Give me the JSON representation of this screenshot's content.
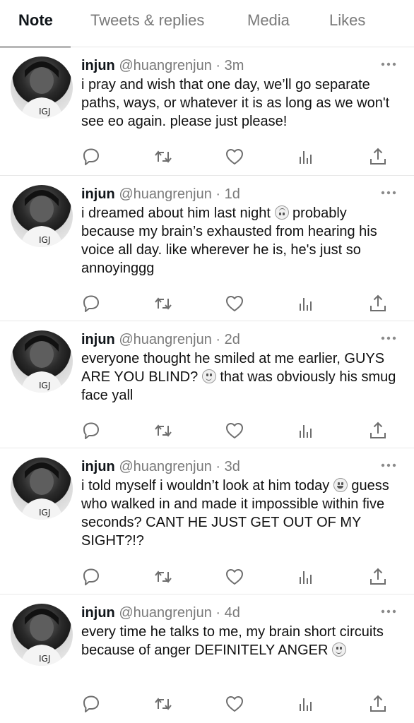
{
  "tabs": [
    {
      "label": "Note",
      "active": true
    },
    {
      "label": "Tweets & replies",
      "active": false
    },
    {
      "label": "Media",
      "active": false
    },
    {
      "label": "Likes",
      "active": false
    }
  ],
  "tweets": [
    {
      "name": "injun",
      "handle": "@huangrenjun",
      "separator": "·",
      "time": "3m",
      "text_parts": [
        "i pray and wish that one day, we’ll go separate paths, ways, or whatever it is as long as we won't see eo again. please just please!"
      ]
    },
    {
      "name": "injun",
      "handle": "@huangrenjun",
      "separator": "·",
      "time": "1d",
      "text_parts": [
        "i dreamed about him last night ",
        " probably because my brain’s exhausted from hearing his voice all day. like wherever he is, he's just so annoyinggg"
      ],
      "emoji": "upside-down-face"
    },
    {
      "name": "injun",
      "handle": "@huangrenjun",
      "separator": "·",
      "time": "2d",
      "text_parts": [
        "everyone thought he smiled at me earlier, GUYS ARE YOU BLIND? ",
        " that was obviously his smug face yall"
      ],
      "emoji": "slightly-smiling-face"
    },
    {
      "name": "injun",
      "handle": "@huangrenjun",
      "separator": "·",
      "time": "3d",
      "text_parts": [
        "i told myself i wouldn’t look at him today ",
        " guess who walked in and made it impossible within five seconds? CANT HE JUST GET OUT OF MY SIGHT?!?"
      ],
      "emoji": "grinning-face"
    },
    {
      "name": "injun",
      "handle": "@huangrenjun",
      "separator": "·",
      "time": "4d",
      "text_parts": [
        "every time he talks to me, my brain short circuits because of anger DEFINITELY ANGER ",
        ""
      ],
      "emoji": "slightly-smiling-face"
    }
  ],
  "action_icons": [
    "reply-icon",
    "retweet-icon",
    "like-icon",
    "analytics-icon",
    "share-icon"
  ],
  "colors": {
    "text": "#0f1419",
    "muted": "#7a7a7a",
    "divider": "#e8e8e8"
  }
}
